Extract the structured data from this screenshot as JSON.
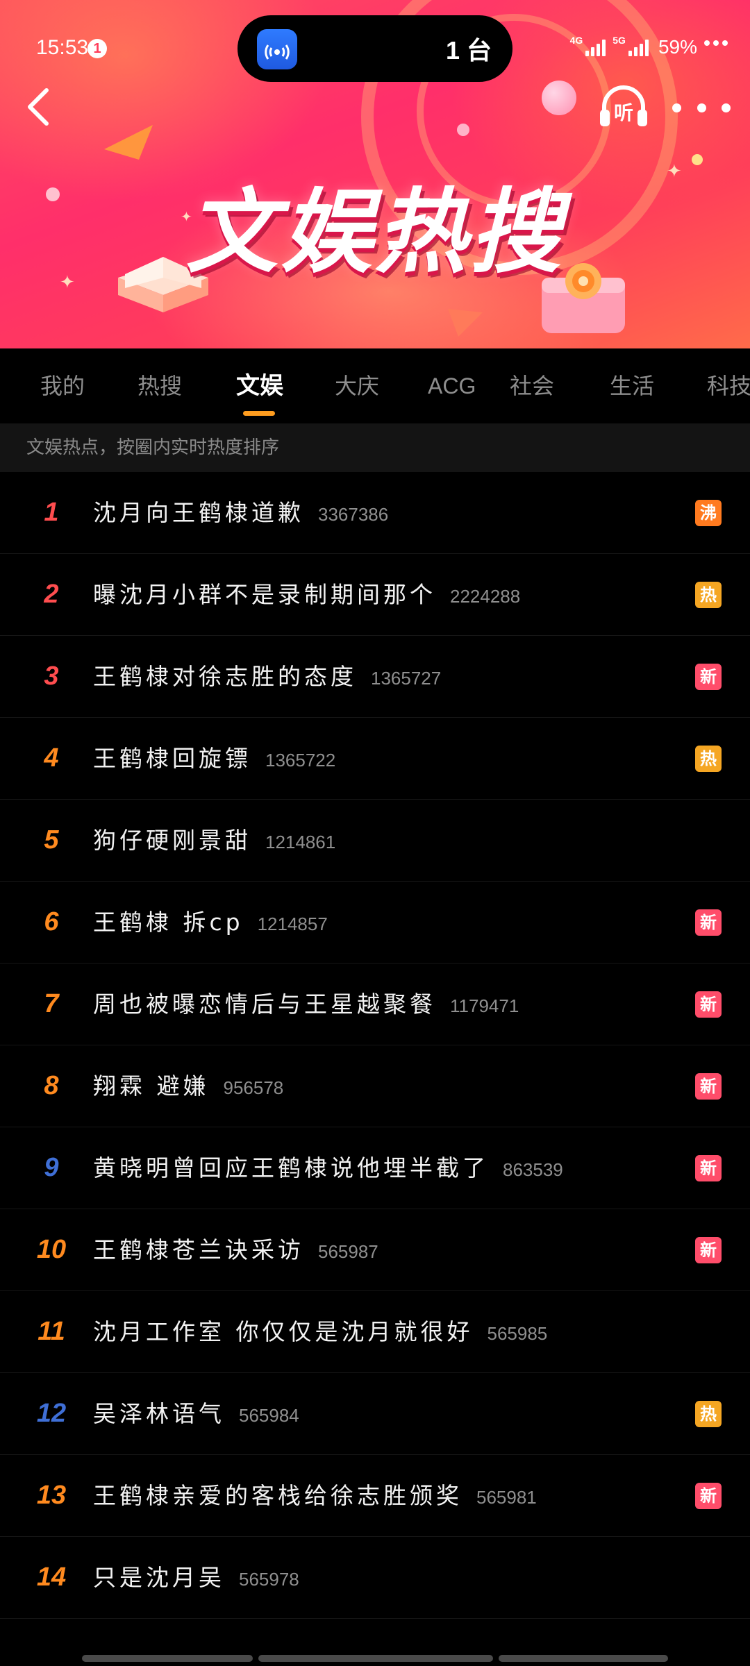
{
  "status_bar": {
    "time": "15:53",
    "notification_count": "1",
    "island_text": "1 台",
    "net1": "4G",
    "net2": "5G",
    "battery": "59%"
  },
  "header": {
    "title": "文娱热搜",
    "listen_label": "听"
  },
  "tabs": [
    {
      "label": "我的",
      "active": false
    },
    {
      "label": "热搜",
      "active": false
    },
    {
      "label": "文娱",
      "active": true
    },
    {
      "label": "大庆",
      "active": false
    },
    {
      "label": "ACG",
      "active": false
    },
    {
      "label": "社会",
      "active": false
    },
    {
      "label": "生活",
      "active": false
    },
    {
      "label": "科技",
      "active": false
    }
  ],
  "subheader": "文娱热点，按圈内实时热度排序",
  "rank_colors": {
    "top": "#ff4d4f",
    "mid": "#ff8a1f",
    "blue": "#3f6fd6"
  },
  "badge_colors": {
    "沸": "#ff7a1f",
    "热": "#f5a623",
    "新": "#ff4d6a"
  },
  "items": [
    {
      "rank": "1",
      "title": "沈月向王鹤棣道歉",
      "heat": "3367386",
      "badge": "沸"
    },
    {
      "rank": "2",
      "title": "曝沈月小群不是录制期间那个",
      "heat": "2224288",
      "badge": "热"
    },
    {
      "rank": "3",
      "title": "王鹤棣对徐志胜的态度",
      "heat": "1365727",
      "badge": "新"
    },
    {
      "rank": "4",
      "title": "王鹤棣回旋镖",
      "heat": "1365722",
      "badge": "热"
    },
    {
      "rank": "5",
      "title": "狗仔硬刚景甜",
      "heat": "1214861",
      "badge": ""
    },
    {
      "rank": "6",
      "title": "王鹤棣 拆cp",
      "heat": "1214857",
      "badge": "新"
    },
    {
      "rank": "7",
      "title": "周也被曝恋情后与王星越聚餐",
      "heat": "1179471",
      "badge": "新"
    },
    {
      "rank": "8",
      "title": "翔霖 避嫌",
      "heat": "956578",
      "badge": "新"
    },
    {
      "rank": "9",
      "title": "黄晓明曾回应王鹤棣说他埋半截了",
      "heat": "863539",
      "badge": "新"
    },
    {
      "rank": "10",
      "title": "王鹤棣苍兰诀采访",
      "heat": "565987",
      "badge": "新"
    },
    {
      "rank": "11",
      "title": "沈月工作室 你仅仅是沈月就很好",
      "heat": "565985",
      "badge": ""
    },
    {
      "rank": "12",
      "title": "吴泽林语气",
      "heat": "565984",
      "badge": "热"
    },
    {
      "rank": "13",
      "title": "王鹤棣亲爱的客栈给徐志胜颁奖",
      "heat": "565981",
      "badge": "新"
    },
    {
      "rank": "14",
      "title": "只是沈月吴",
      "heat": "565978",
      "badge": ""
    }
  ]
}
